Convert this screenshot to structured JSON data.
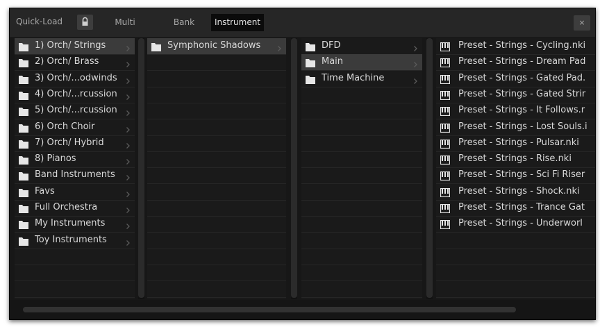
{
  "topbar": {
    "quickload_label": "Quick-Load",
    "tabs": [
      {
        "label": "Multi"
      },
      {
        "label": "Bank"
      },
      {
        "label": "Instrument"
      }
    ],
    "close_label": "×"
  },
  "columns": [
    {
      "items": [
        {
          "label": "1) Orch/ Strings",
          "selected": true
        },
        {
          "label": "2) Orch/ Brass"
        },
        {
          "label": "3) Orch/...odwinds"
        },
        {
          "label": "4) Orch/...rcussion"
        },
        {
          "label": "5) Orch/...rcussion"
        },
        {
          "label": "6) Orch Choir"
        },
        {
          "label": "7) Orch/ Hybrid"
        },
        {
          "label": "8) Pianos"
        },
        {
          "label": "Band Instruments"
        },
        {
          "label": "Favs"
        },
        {
          "label": "Full Orchestra"
        },
        {
          "label": "My Instruments"
        },
        {
          "label": "Toy Instruments"
        }
      ]
    },
    {
      "items": [
        {
          "label": "Symphonic Shadows",
          "selected": true
        }
      ]
    },
    {
      "items": [
        {
          "label": "DFD"
        },
        {
          "label": "Main",
          "selected": true
        },
        {
          "label": "Time Machine"
        }
      ]
    },
    {
      "items": [
        {
          "label": "Preset - Strings - Cycling.nki"
        },
        {
          "label": "Preset - Strings - Dream Pad"
        },
        {
          "label": "Preset - Strings - Gated Pad."
        },
        {
          "label": "Preset - Strings - Gated Strir"
        },
        {
          "label": "Preset - Strings - It Follows.r"
        },
        {
          "label": "Preset - Strings - Lost Souls.i"
        },
        {
          "label": "Preset - Strings - Pulsar.nki"
        },
        {
          "label": "Preset - Strings - Rise.nki"
        },
        {
          "label": "Preset - Strings - Sci Fi Riser"
        },
        {
          "label": "Preset - Strings - Shock.nki"
        },
        {
          "label": "Preset - Strings - Trance Gat"
        },
        {
          "label": "Preset - Strings - Underworl"
        }
      ]
    }
  ],
  "icons": {
    "folder": "folder-icon",
    "instrument": "instrument-file-icon",
    "lock": "lock-icon",
    "chevron": "chevron-right-icon"
  }
}
